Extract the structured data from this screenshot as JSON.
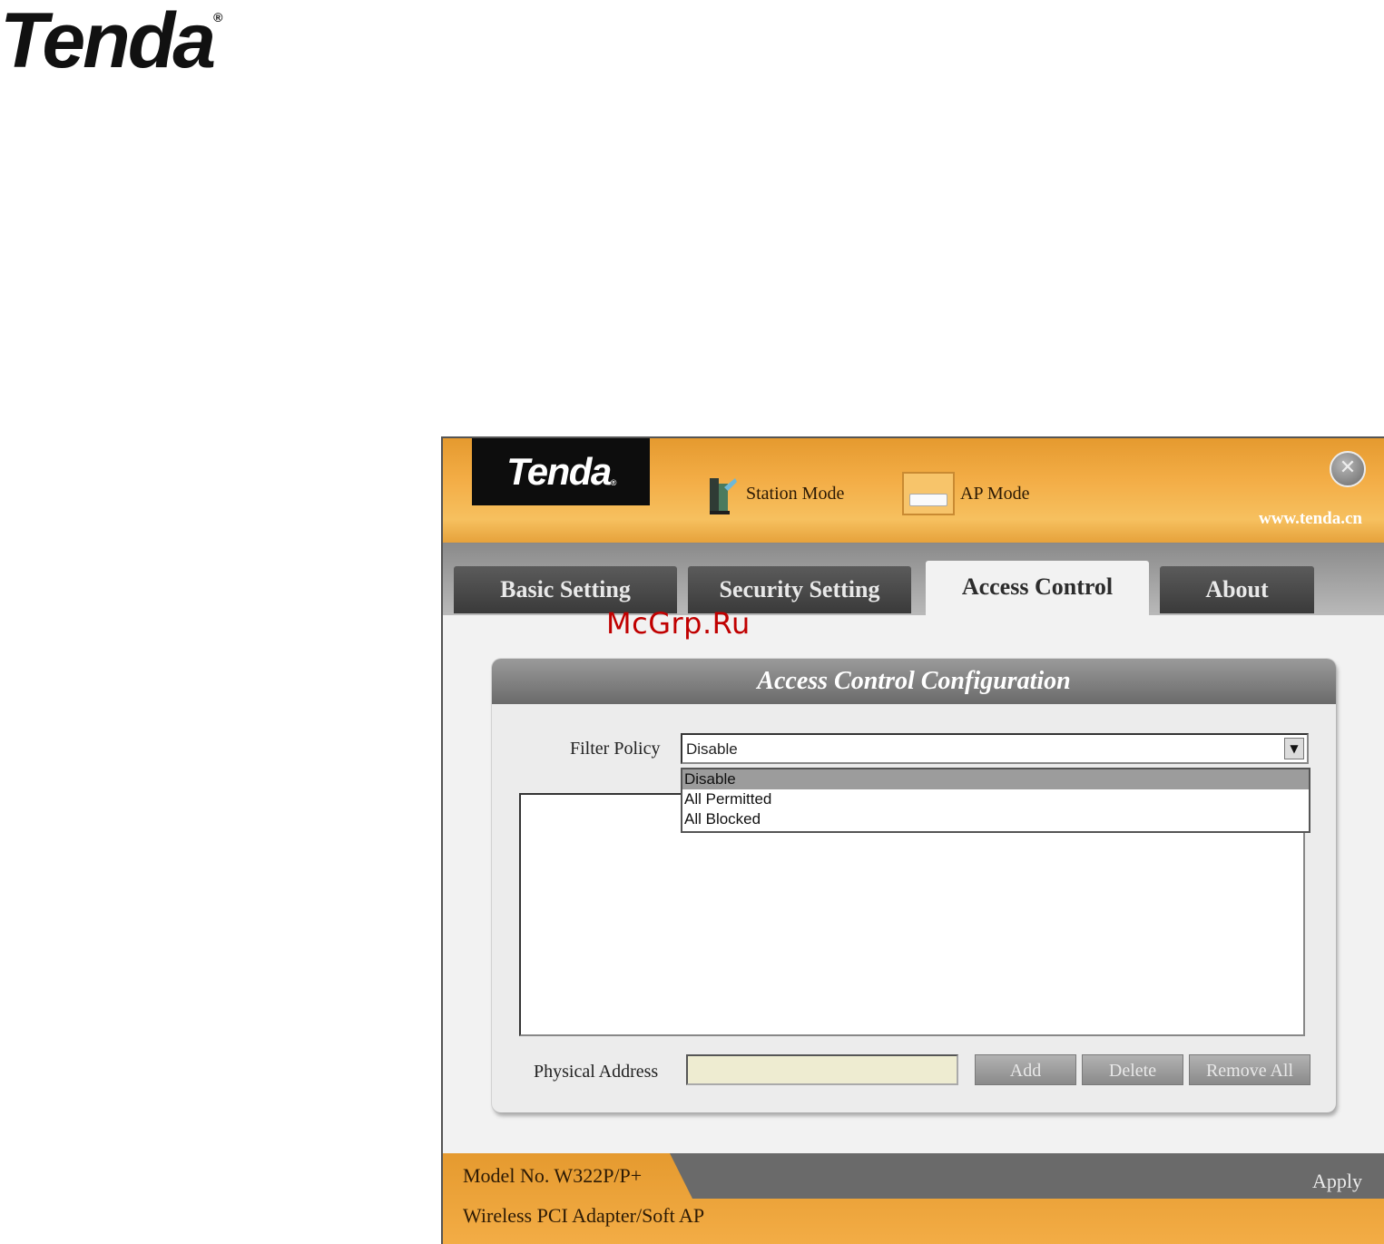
{
  "page": {
    "logo_text": "Tenda",
    "logo_mark": "®",
    "watermark": "McGrp.Ru"
  },
  "window": {
    "header": {
      "logo_text": "Tenda",
      "logo_mark": "®",
      "modes": [
        {
          "label": "Station Mode",
          "icon": "station-mode-icon"
        },
        {
          "label": "AP Mode",
          "icon": "ap-mode-icon"
        }
      ],
      "close_icon": "close-icon",
      "url": "www.tenda.cn"
    },
    "tabs": [
      {
        "label": "Basic Setting",
        "active": false
      },
      {
        "label": "Security Setting",
        "active": false
      },
      {
        "label": "Access Control",
        "active": true
      },
      {
        "label": "About",
        "active": false
      }
    ],
    "panel": {
      "title": "Access Control Configuration",
      "filter_label": "Filter Policy",
      "filter_value": "Disable",
      "filter_options": [
        "Disable",
        "All Permitted",
        "All Blocked"
      ],
      "selected_option_index": 0,
      "mac_list": [],
      "address_label": "Physical Address",
      "address_value": "",
      "buttons": {
        "add": "Add",
        "delete": "Delete",
        "remove_all": "Remove All"
      }
    },
    "footer": {
      "model": "Model No.  W322P/P+",
      "product": "Wireless PCI Adapter/Soft AP",
      "apply": "Apply"
    }
  },
  "colors": {
    "header_orange": "#f3ad46",
    "tab_dark": "#4a4a4a",
    "panel_header_gray": "#808080",
    "address_input_bg": "#eeecd1",
    "watermark_red": "#c00000"
  }
}
